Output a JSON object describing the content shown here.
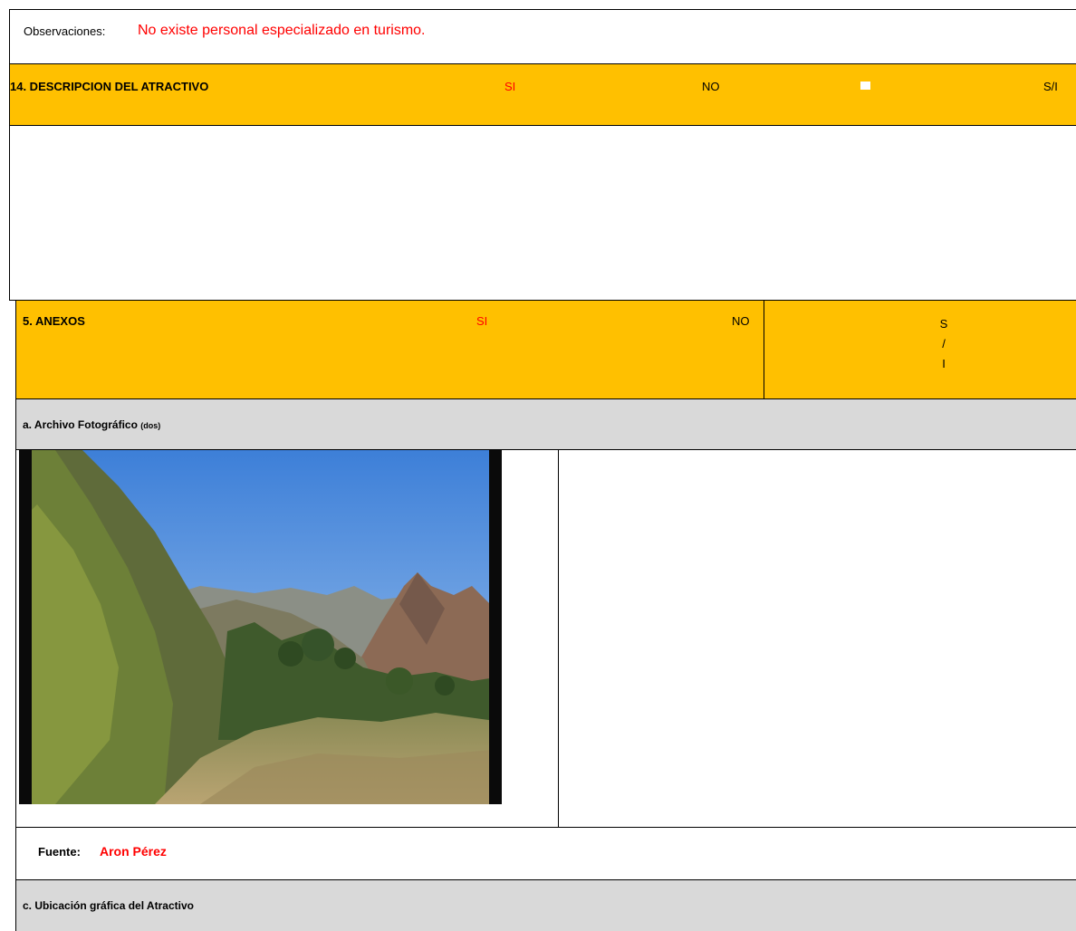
{
  "observations": {
    "label": "Observaciones:",
    "value": "No existe personal especializado en turismo."
  },
  "section14": {
    "title": "14. DESCRIPCION DEL ATRACTIVO",
    "opt_si": "SI",
    "opt_no": "NO",
    "opt_si2": "S/I",
    "colors": {
      "header_bg": "#ffc000",
      "option_highlight": "#ff0000"
    }
  },
  "section5": {
    "title": "5. ANEXOS",
    "opt_si": "SI",
    "opt_no": "NO",
    "opt_si2_chars": [
      "S",
      "/",
      "I"
    ]
  },
  "photo_archive": {
    "title": "a. Archivo Fotográfico",
    "note": "(dos)",
    "colors": {
      "header_bg": "#d9d9d9"
    }
  },
  "source": {
    "label": "Fuente:",
    "value": "Aron Pérez"
  },
  "map_section": {
    "title": "c. Ubicación gráfica del Atractivo"
  }
}
